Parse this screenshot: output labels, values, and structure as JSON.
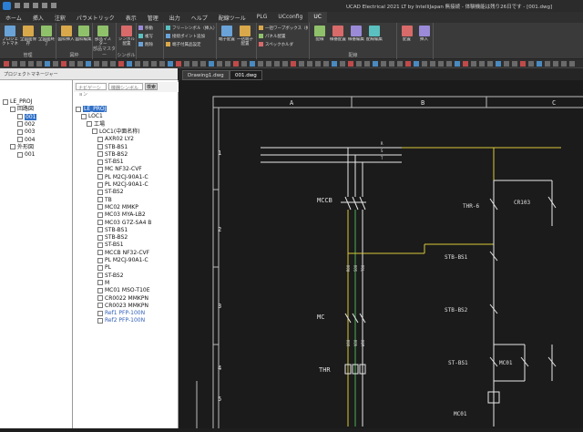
{
  "window": {
    "title": "UCAD Electrical 2021 LT by IntelliJapan 無接続 - 体験機能は残り26日です - [001.dwg]"
  },
  "menu_tabs": [
    "ホーム",
    "挿入",
    "注釈",
    "パラメトリック",
    "表示",
    "管理",
    "出力",
    "ヘルプ",
    "配線ツール",
    "PLG",
    "UCconfig",
    "UC"
  ],
  "active_tab_index": 11,
  "ribbon": {
    "groups": [
      {
        "label": "管理",
        "buttons": [
          "プロジェクトマネージャー",
          "全図面保存",
          "全図面終了"
        ]
      },
      {
        "label": "図枠",
        "buttons": [
          "図枠挿入",
          "図枠編集"
        ]
      },
      {
        "label": "部品マスター",
        "buttons": [
          "部品マスター"
        ]
      },
      {
        "label": "シンボル",
        "buttons": [
          "シンボル配置"
        ]
      },
      {
        "label": "",
        "small": [
          "移動",
          "複写",
          "削除"
        ]
      },
      {
        "label": "",
        "small": [
          "フリーシンボル（挿入）",
          "接続ポイント追加",
          "端子付属品設定"
        ]
      },
      {
        "label": "",
        "buttons": [
          "端子配置",
          "一括端子配置"
        ]
      },
      {
        "label": "",
        "small": [
          "一括ワープボックス（挿入）",
          "パネル配置",
          "スペックホルダ"
        ]
      },
      {
        "label": "配線",
        "buttons": [
          "配線",
          "線番配置",
          "線番編集",
          "配線編集"
        ]
      },
      {
        "label": "",
        "buttons": [
          "配置",
          "挿入"
        ]
      }
    ]
  },
  "left_panel": {
    "header": "プロジェクトマネージャー",
    "tree": [
      {
        "label": "LE_PROJ",
        "level": 0
      },
      {
        "label": "回路図",
        "level": 1
      },
      {
        "label": "001",
        "level": 2,
        "selected": true
      },
      {
        "label": "002",
        "level": 2
      },
      {
        "label": "003",
        "level": 2
      },
      {
        "label": "004",
        "level": 2
      },
      {
        "label": "外形図",
        "level": 1
      },
      {
        "label": "001",
        "level": 2
      }
    ]
  },
  "middle_panel": {
    "filter_placeholder": "機器シンボル",
    "search_placeholder": "ナビゲーション",
    "search_button": "検索",
    "tree": [
      {
        "label": "LE_PROJ",
        "level": 0,
        "selected": true
      },
      {
        "label": "LOC1",
        "level": 1
      },
      {
        "label": "工場",
        "level": 2
      },
      {
        "label": "LOC1(中面名称)",
        "level": 3
      },
      {
        "label": "AXR02 LY2",
        "level": 4
      },
      {
        "label": "STB-BS1",
        "level": 4
      },
      {
        "label": "STB-BS2",
        "level": 4
      },
      {
        "label": "ST-BS1",
        "level": 4
      },
      {
        "label": "MC NF32-CVF",
        "level": 4
      },
      {
        "label": "PL M2CJ-90A1-C",
        "level": 4
      },
      {
        "label": "PL M2CJ-90A1-C",
        "level": 4
      },
      {
        "label": "ST-BS2",
        "level": 4
      },
      {
        "label": "TB",
        "level": 4
      },
      {
        "label": "MC02 MMKP",
        "level": 4
      },
      {
        "label": "MC03 MYA-LB2",
        "level": 4
      },
      {
        "label": "MC03 G7Z-SA4 B",
        "level": 4
      },
      {
        "label": "STB-BS1",
        "level": 4
      },
      {
        "label": "STB-BS2",
        "level": 4
      },
      {
        "label": "ST-BS1",
        "level": 4
      },
      {
        "label": "MCCB NF32-CVF",
        "level": 4
      },
      {
        "label": "PL M2CJ-90A1-C",
        "level": 4
      },
      {
        "label": "PL",
        "level": 4
      },
      {
        "label": "ST-BS2",
        "level": 4
      },
      {
        "label": "M",
        "level": 4
      },
      {
        "label": "MC01 MSO-T10E",
        "level": 4
      },
      {
        "label": "CR0022 MMKPN",
        "level": 4
      },
      {
        "label": "CR0023 MMKPN",
        "level": 4
      },
      {
        "label": "Ref1 PFP-100N",
        "level": 4,
        "blue": true
      },
      {
        "label": "Ref2 PFP-100N",
        "level": 4,
        "blue": true
      }
    ]
  },
  "drawing_tabs": [
    "Drawing1.dwg",
    "001.dwg"
  ],
  "active_drawing_tab": 1,
  "schematic": {
    "column_labels": [
      "A",
      "B",
      "C"
    ],
    "row_labels": [
      "1",
      "2",
      "3",
      "4",
      "5"
    ],
    "component_labels": [
      "MCCB",
      "MC",
      "THR",
      "THR-6",
      "CR103",
      "STB-BS1",
      "STB-BS2",
      "ST-BS1",
      "MC01",
      "MC01"
    ],
    "wire_labels": [
      "R",
      "S",
      "T",
      "R00",
      "S00",
      "T00",
      "U00",
      "V00",
      "W00"
    ]
  },
  "colors": {
    "canvas_bg": "#1b1b1b",
    "wire": "#e8e8e8",
    "highlight_wire": "#d8c838",
    "green_wire": "#4caf50",
    "selection": "#2f6fc7"
  }
}
